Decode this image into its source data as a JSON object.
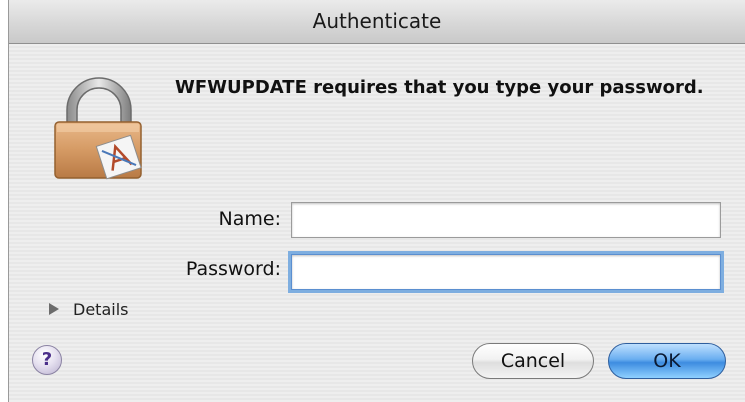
{
  "window": {
    "title": "Authenticate"
  },
  "message": "WFWUPDATE requires that you type your password.",
  "form": {
    "name_label": "Name:",
    "name_value": "",
    "password_label": "Password:",
    "password_value": ""
  },
  "details": {
    "label": "Details"
  },
  "help": {
    "label": "?"
  },
  "buttons": {
    "cancel": "Cancel",
    "ok": "OK"
  },
  "icons": {
    "lock": "lock-icon",
    "disclosure": "disclosure-triangle-icon",
    "help": "help-icon"
  },
  "colors": {
    "focus_ring": "#7eaee0",
    "ok_button": "#3d8ce0"
  }
}
